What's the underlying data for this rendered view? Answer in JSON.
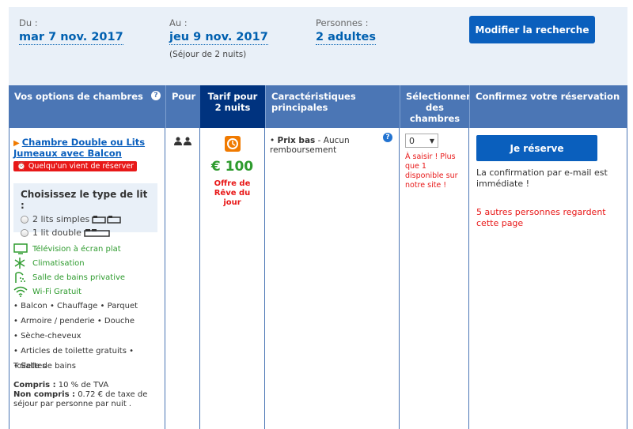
{
  "search": {
    "checkin_label": "Du :",
    "checkin_value": "mar 7 nov. 2017",
    "checkout_label": "Au :",
    "checkout_value": "jeu 9 nov. 2017",
    "stay_note": "(Séjour de 2 nuits)",
    "persons_label": "Personnes :",
    "persons_value": "2 adultes",
    "modify_button": "Modifier la recherche"
  },
  "table": {
    "headers": {
      "options": "Vos options de chambres",
      "for": "Pour",
      "rate": "Tarif pour 2 nuits",
      "features": "Caractéristiques principales",
      "select": "Sélectionner des chambres",
      "confirm": "Confirmez votre réservation"
    }
  },
  "room": {
    "name": "Chambre Double ou Lits Jumeaux avec Balcon",
    "alert": "Quelqu'un vient de réserver",
    "bed_title": "Choisissez le type de lit :",
    "bed_options": [
      "2 lits simples",
      "1 lit double"
    ],
    "amenities_highlight": [
      "Télévision à écran plat",
      "Climatisation",
      "Salle de bains privative",
      "Wi-Fi Gratuit"
    ],
    "amenities_list": [
      "• Balcon  • Chauffage  • Parquet",
      "• Armoire / penderie  • Douche",
      "• Sèche-cheveux",
      "• Articles de toilette gratuits  • Toilettes",
      "• Salle de bains"
    ],
    "included_label": "Compris :",
    "included_value": " 10 % de TVA",
    "not_included_label": "Non compris :",
    "not_included_value": " 0.72 € de taxe de séjour par personne par nuit ."
  },
  "rate": {
    "price": "€ 100",
    "deal": "Offre de Rêve du jour"
  },
  "features": {
    "item_bold": "Prix bas",
    "item_rest": " - Aucun remboursement"
  },
  "select": {
    "value": "0",
    "availability": "À saisir ! Plus que 1 disponible sur notre site !"
  },
  "confirm": {
    "button": "Je réserve",
    "text": "La confirmation par e-mail est immédiate !",
    "others": "5 autres personnes regardent cette page"
  },
  "colors": {
    "header_blue": "#4b76b5",
    "header_dark": "#00337f",
    "button_blue": "#0a5fbd",
    "price_green": "#2e9b2e",
    "alert_red": "#e81818",
    "deal_orange": "#f07a00"
  }
}
